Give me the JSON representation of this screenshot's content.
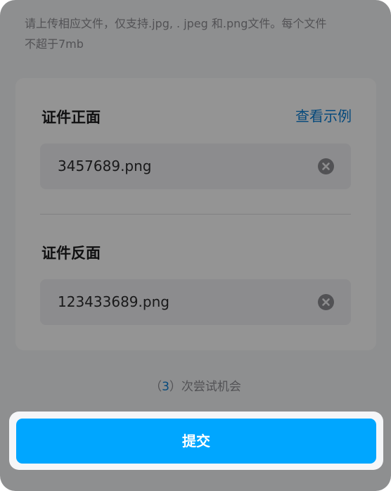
{
  "notice": {
    "text": "请上传相应文件，仅支持.jpg, . jpeg 和.png文件。每个文件\n不超于7mb"
  },
  "front": {
    "title": "证件正面",
    "example_link": "查看示例",
    "file_name": "3457689.png",
    "clear_icon": "clear-circle-x-icon"
  },
  "back": {
    "title": "证件反面",
    "file_name": "123433689.png",
    "clear_icon": "clear-circle-x-icon"
  },
  "attempts": {
    "open_paren": "（",
    "count": "3",
    "suffix": "）次尝试机会"
  },
  "submit": {
    "label": "提交"
  },
  "colors": {
    "accent": "#00a6ff",
    "link": "#0a7fd6",
    "overlay": "rgba(0,0,0,0.42)"
  }
}
